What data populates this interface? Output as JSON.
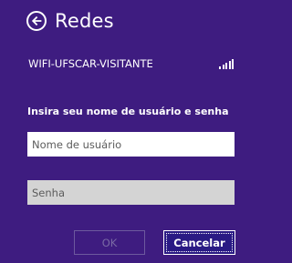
{
  "header": {
    "title": "Redes",
    "back_icon": "back-arrow-icon"
  },
  "network": {
    "name": "WIFI-UFSCAR-VISITANTE",
    "signal_icon": "signal-strength-icon"
  },
  "form": {
    "prompt": "Insira seu nome de usuário e senha",
    "username": {
      "value": "",
      "placeholder": "Nome de usuário"
    },
    "password": {
      "value": "",
      "placeholder": "Senha"
    }
  },
  "buttons": {
    "ok_label": "OK",
    "ok_enabled": false,
    "cancel_label": "Cancelar"
  },
  "colors": {
    "background": "#3e1c80",
    "text": "#ffffff",
    "disabled_text": "#7a6aa4",
    "password_field": "#d4d4d4",
    "cancel_fill": "#2a1a84"
  }
}
